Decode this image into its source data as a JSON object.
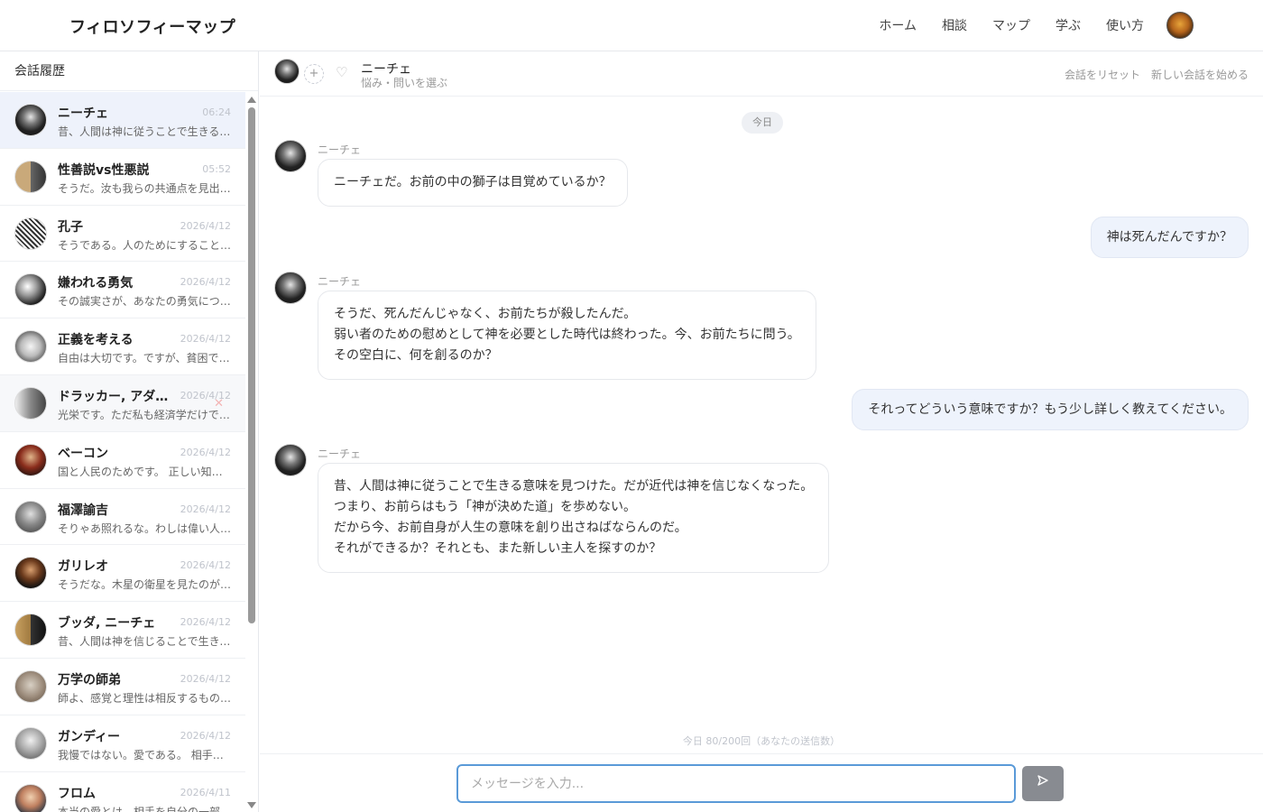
{
  "header": {
    "brand": "フィロソフィーマップ",
    "nav": [
      "ホーム",
      "相談",
      "マップ",
      "学ぶ",
      "使い方"
    ]
  },
  "sidebar": {
    "title": "会話履歴",
    "conversations": [
      {
        "name": "ニーチェ",
        "time": "06:24",
        "preview": "昔、人間は神に従うことで生きる意味を見つけた。",
        "active": true
      },
      {
        "name": "性善説vs性悪説",
        "time": "05:52",
        "preview": "そうだ。汝も我らの共通点を見出すとは。"
      },
      {
        "name": "孔子",
        "time": "2026/4/12",
        "preview": "そうである。人のためにすることこそ仁である。"
      },
      {
        "name": "嫌われる勇気",
        "time": "2026/4/12",
        "preview": "その誠実さが、あなたの勇気につながります。"
      },
      {
        "name": "正義を考える",
        "time": "2026/4/12",
        "preview": "自由は大切です。ですが、貧困では自由はない。"
      },
      {
        "name": "ドラッカー, アダム・スミス",
        "time": "2026/4/12",
        "preview": "光栄です。ただ私も経済学だけでは語れない。"
      },
      {
        "name": "ベーコン",
        "time": "2026/4/12",
        "preview": "国と人民のためです。 正しい知識こそ力なり。"
      },
      {
        "name": "福澤諭吉",
        "time": "2026/4/12",
        "preview": "そりゃあ照れるな。わしは偉い人ではない。"
      },
      {
        "name": "ガリレオ",
        "time": "2026/4/12",
        "preview": "そうだな。木星の衛星を見たのが始まりだ。"
      },
      {
        "name": "ブッダ, ニーチェ",
        "time": "2026/4/12",
        "preview": "昔、人間は神を信じることで生きる意味を得た。"
      },
      {
        "name": "万学の師弟",
        "time": "2026/4/12",
        "preview": "師よ、感覚と理性は相反するものでしょうか。"
      },
      {
        "name": "ガンディー",
        "time": "2026/4/12",
        "preview": "我慢ではない。愛である。 相手を思うこと。"
      },
      {
        "name": "フロム",
        "time": "2026/4/11",
        "preview": "本当の愛とは、相手を自分の一部と感じること。"
      }
    ]
  },
  "chat": {
    "name": "ニーチェ",
    "subtitle": "悩み・問いを選ぶ",
    "reset_label": "会話をリセット",
    "new_label": "新しい会話を始める",
    "add_label": "+",
    "date": "今日",
    "messages": [
      {
        "role": "bot",
        "sender": "ニーチェ",
        "lines": [
          "ニーチェだ。お前の中の獅子は目覚めているか？"
        ]
      },
      {
        "role": "user",
        "lines": [
          "神は死んだんですか？"
        ]
      },
      {
        "role": "bot",
        "sender": "ニーチェ",
        "lines": [
          "そうだ、死んだんじゃなく、お前たちが殺したんだ。",
          "弱い者のための慰めとして神を必要とした時代は終わった。今、お前たちに問う。",
          "その空白に、何を創るのか？"
        ]
      },
      {
        "role": "user",
        "lines": [
          "それってどういう意味ですか？もう少し詳しく教えてください。"
        ]
      },
      {
        "role": "bot",
        "sender": "ニーチェ",
        "lines": [
          "昔、人間は神に従うことで生きる意味を見つけた。だが近代は神を信じなくなった。",
          "つまり、お前らはもう「神が決めた道」を歩めない。",
          "だから今、お前自身が人生の意味を創り出さねばならんのだ。",
          "それができるか？それとも、また新しい主人を探すのか？"
        ]
      }
    ]
  },
  "quota": "今日 80/200回（あなたの送信数）",
  "composer": {
    "placeholder": "メッセージを入力...",
    "value": ""
  },
  "icons": {
    "send": "send-icon",
    "heart": "heart-icon",
    "delete": "close-icon"
  },
  "colors": {
    "accent": "#5a9ad8",
    "user_bubble": "#eef3fc",
    "send_button": "#888b91"
  }
}
